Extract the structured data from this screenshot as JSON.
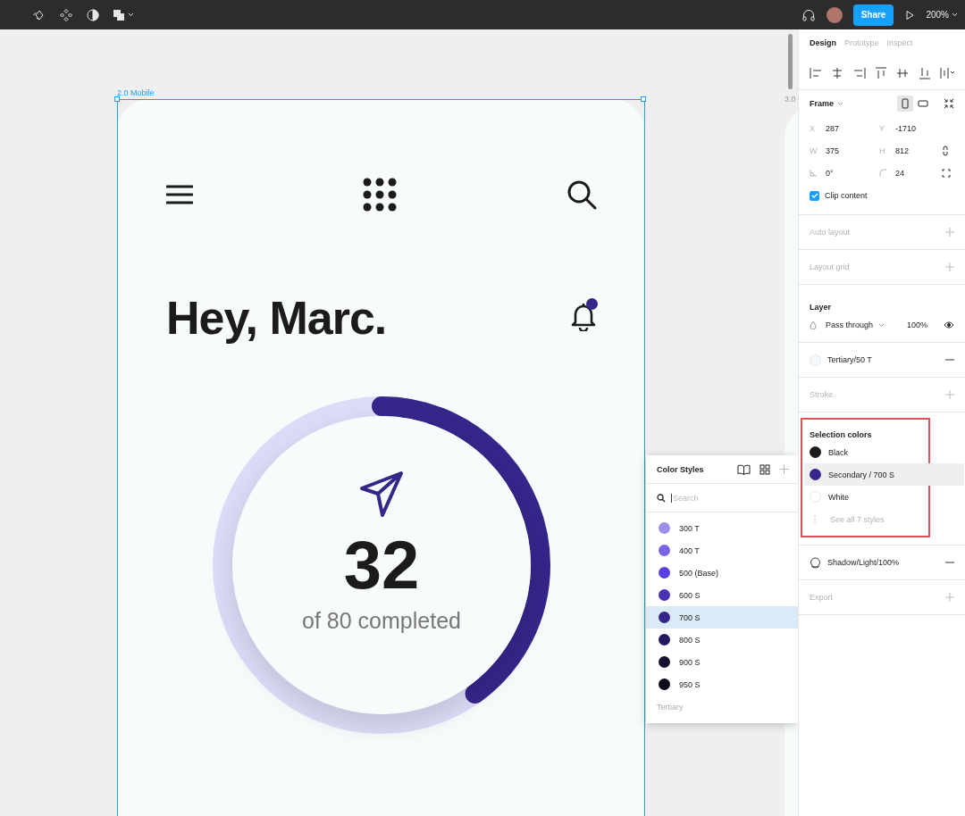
{
  "toolbar": {
    "share_button": "Share",
    "zoom": "200%"
  },
  "canvas": {
    "frames": [
      {
        "label": "2.0 Mobile",
        "selected": true
      },
      {
        "label": "3.0",
        "selected": false
      }
    ]
  },
  "mobile_screen": {
    "greeting": "Hey, Marc.",
    "notification_unread": true,
    "progress": {
      "level": 0.4,
      "count": "32",
      "caption": "of 80 completed"
    }
  },
  "color_styles": {
    "title": "Color Styles",
    "search": {
      "placeholder": "Search"
    },
    "items": [
      {
        "name": "300 T",
        "color": "#9d8ee9",
        "selected": false
      },
      {
        "name": "400 T",
        "color": "#7b63e4",
        "selected": false
      },
      {
        "name": "500 (Base)",
        "color": "#5a3fe0",
        "selected": false
      },
      {
        "name": "600 S",
        "color": "#4631b5",
        "selected": false
      },
      {
        "name": "700 S",
        "color": "#35268a",
        "selected": true
      },
      {
        "name": "800 S",
        "color": "#24195e",
        "selected": false
      },
      {
        "name": "900 S",
        "color": "#14102e",
        "selected": false
      },
      {
        "name": "950 S",
        "color": "#0b0a18",
        "selected": false
      }
    ],
    "group_label": "Tertiary"
  },
  "design_panel": {
    "tabs": [
      {
        "label": "Design",
        "selected": true
      },
      {
        "label": "Prototype",
        "selected": false
      },
      {
        "label": "Inspect",
        "selected": false
      }
    ],
    "frame": {
      "title": "Frame",
      "orientation_buttons": [
        {
          "kind": "portrait",
          "selected": true
        },
        {
          "kind": "landscape",
          "selected": false
        }
      ],
      "fields": [
        {
          "kind": "lettered",
          "label": "X",
          "value": "287"
        },
        {
          "kind": "lettered",
          "label": "Y",
          "value": "-1710"
        },
        {
          "kind": "lettered",
          "label": "W",
          "value": "375"
        },
        {
          "kind": "lettered",
          "label": "H",
          "value": "812"
        },
        {
          "kind": "rotation",
          "value": "0°"
        },
        {
          "kind": "radius",
          "value": "24"
        }
      ],
      "clip_content": {
        "label": "Clip content",
        "checked": true
      }
    },
    "auto_layout": "Auto layout",
    "layout_grid": "Layout grid",
    "layer": {
      "title": "Layer",
      "blend_mode": "Pass through",
      "opacity": "100%"
    },
    "fill": {
      "name": "Tertiary/50 T",
      "color": "#f5f9fb"
    },
    "stroke": "Stroke",
    "selection_colors": {
      "title": "Selection colors",
      "items": [
        {
          "name": "Black",
          "color": "#1b1b1b",
          "selected": false
        },
        {
          "name": "Secondary / 700 S",
          "color": "#35268a",
          "selected": true
        },
        {
          "name": "White",
          "color": "#ffffff",
          "selected": false
        }
      ],
      "see_all": "See all 7 styles"
    },
    "effect": {
      "name": "Shadow/Light/100%"
    },
    "export": "Export"
  }
}
